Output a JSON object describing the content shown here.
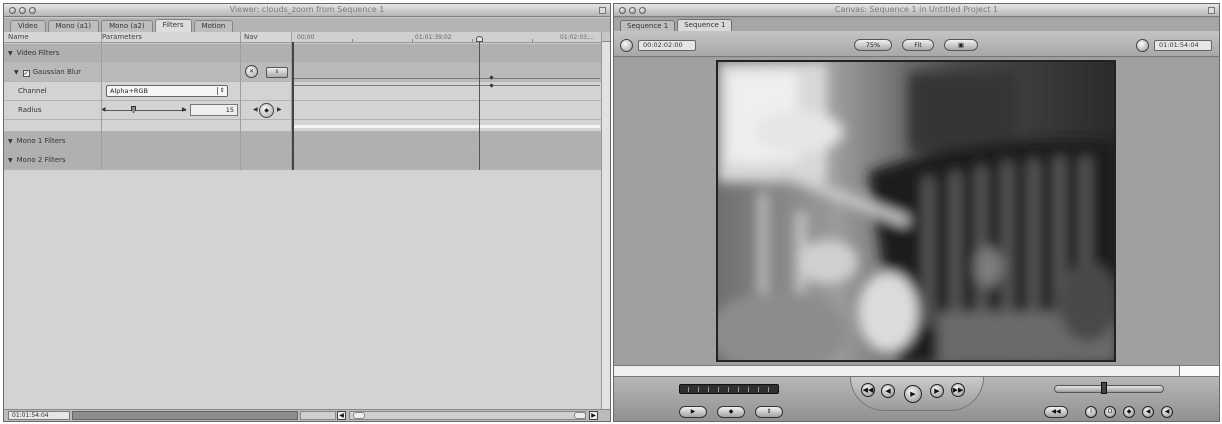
{
  "viewer": {
    "title": "Viewer: clouds_zoom from Sequence 1",
    "tabs": [
      "Video",
      "Mono (a1)",
      "Mono (a2)",
      "Filters",
      "Motion"
    ],
    "active_tab": "Filters",
    "columns": {
      "name": "Name",
      "parameters": "Parameters",
      "nav": "Nav"
    },
    "ruler_labels": [
      "00;00",
      "01:01:39;02",
      "01:02:03;..."
    ],
    "rows": {
      "video_filters": "Video Filters",
      "gaussian_blur": "Gaussian Blur",
      "gaussian_blur_check": "✓",
      "channel_label": "Channel",
      "channel_value": "Alpha+RGB",
      "radius_label": "Radius",
      "radius_value": "15",
      "mono1": "Mono 1 Filters",
      "mono2": "Mono 2 Filters"
    },
    "bottom_timecode": "01:01:54:04"
  },
  "canvas": {
    "title": "Canvas: Sequence 1 in Untitled Project 1",
    "tabs": [
      "Sequence 1",
      "Sequence 1"
    ],
    "active_tab_index": 1,
    "timecode_duration": "00:02:02:00",
    "timecode_current": "01:01:54:04",
    "zoom": "75%",
    "view_menu": "Fit",
    "overlay_menu": "▣"
  },
  "glyphs": {
    "triangle_down": "▼",
    "arrow_left": "◀",
    "arrow_right": "▶",
    "updown": "⇕",
    "reset": "✕",
    "keyframe": "◆",
    "play": "▶",
    "prev": "◀◀",
    "next": "▶▶",
    "mark_in": "I",
    "mark_out": "O"
  },
  "colors": {
    "window_bg": "#c9c9c9",
    "canvas_bg": "#9c9c9c",
    "video_dark": "#3c3c3c"
  },
  "icons": [
    "close-icon",
    "minimize-icon",
    "zoom-icon",
    "disclosure-triangle-icon",
    "checkbox-icon",
    "reset-icon",
    "keyframe-icon",
    "play-icon",
    "rewind-icon",
    "forward-icon",
    "mark-in-icon",
    "mark-out-icon"
  ]
}
